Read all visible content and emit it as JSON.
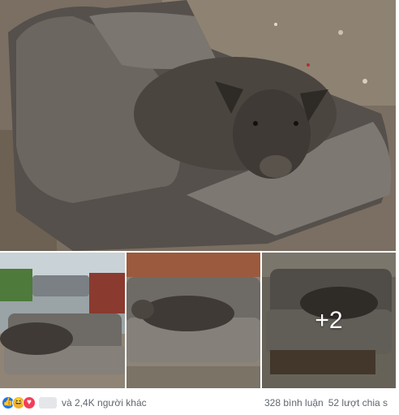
{
  "post": {
    "photos": [
      {
        "name": "pig-on-sofa-closeup"
      },
      {
        "name": "sofa-in-yard"
      },
      {
        "name": "pig-lying-on-sofa"
      },
      {
        "name": "sofa-side-view"
      }
    ],
    "more_photos_label": "+2"
  },
  "footer": {
    "reaction_icons": [
      "like-icon",
      "haha-icon",
      "love-icon"
    ],
    "reaction_colors": {
      "like": "#1877f2",
      "haha": "#f7b125",
      "love": "#f33e58"
    },
    "reaction_summary": "và 2,4K người khác",
    "comments": "328 bình luận",
    "shares": "52 lượt chia s"
  }
}
